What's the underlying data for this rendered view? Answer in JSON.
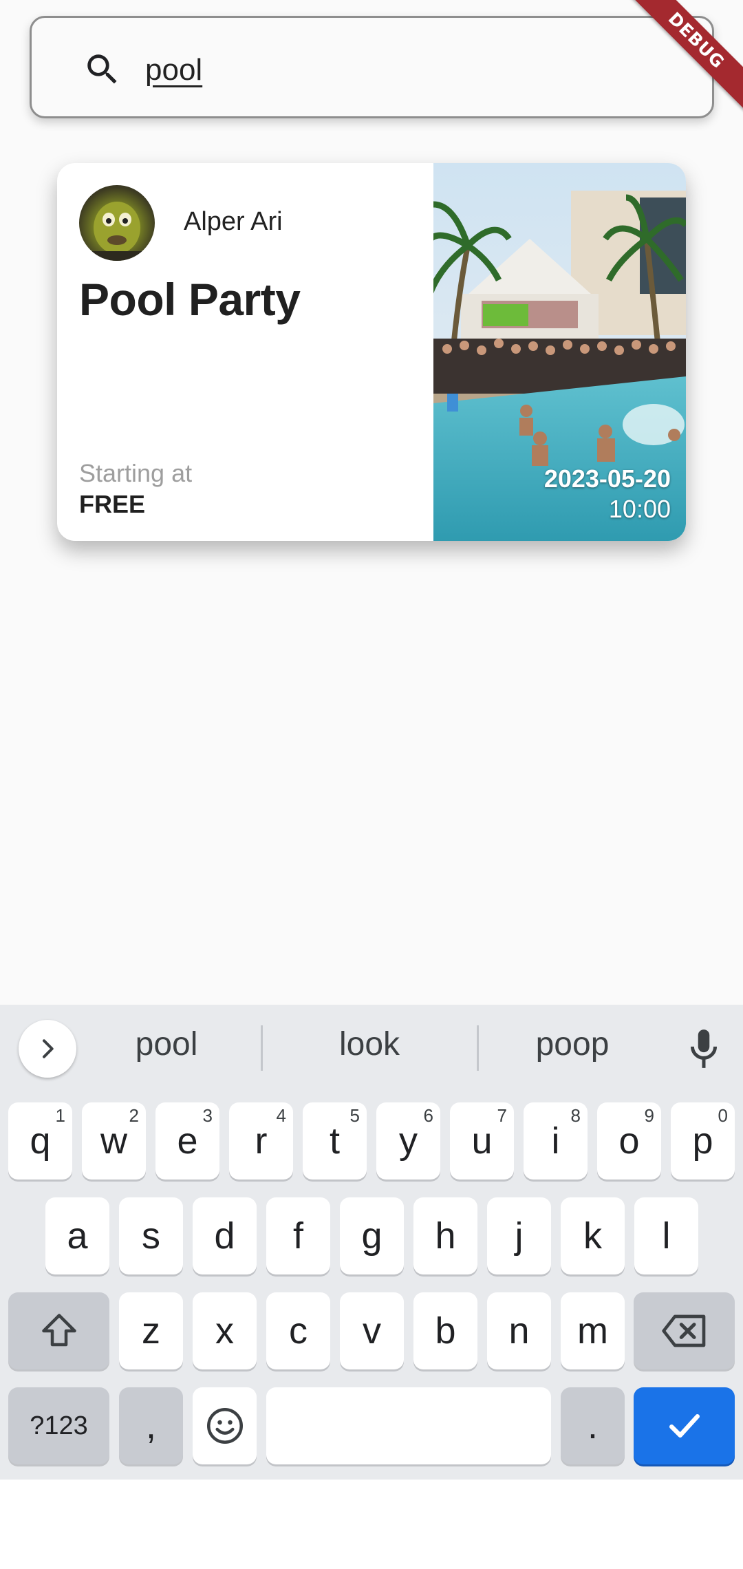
{
  "search": {
    "value": "pool",
    "icon": "search-icon"
  },
  "debug_banner": {
    "label": "DEBUG",
    "color": "#a4292f"
  },
  "event_card": {
    "host_name": "Alper Ari",
    "title": "Pool Party",
    "price_label": "Starting at",
    "price_value": "FREE",
    "date": "2023-05-20",
    "time": "10:00"
  },
  "keyboard": {
    "suggestions": [
      "pool",
      "look",
      "poop"
    ],
    "rows": [
      [
        {
          "label": "q",
          "hint": "1"
        },
        {
          "label": "w",
          "hint": "2"
        },
        {
          "label": "e",
          "hint": "3"
        },
        {
          "label": "r",
          "hint": "4"
        },
        {
          "label": "t",
          "hint": "5"
        },
        {
          "label": "y",
          "hint": "6"
        },
        {
          "label": "u",
          "hint": "7"
        },
        {
          "label": "i",
          "hint": "8"
        },
        {
          "label": "o",
          "hint": "9"
        },
        {
          "label": "p",
          "hint": "0"
        }
      ],
      [
        {
          "label": "a"
        },
        {
          "label": "s"
        },
        {
          "label": "d"
        },
        {
          "label": "f"
        },
        {
          "label": "g"
        },
        {
          "label": "h"
        },
        {
          "label": "j"
        },
        {
          "label": "k"
        },
        {
          "label": "l"
        }
      ],
      [
        {
          "label": "z"
        },
        {
          "label": "x"
        },
        {
          "label": "c"
        },
        {
          "label": "v"
        },
        {
          "label": "b"
        },
        {
          "label": "n"
        },
        {
          "label": "m"
        }
      ]
    ],
    "symbols_key": "?123",
    "comma_key": ",",
    "period_key": ".",
    "accent_color": "#1a73e8"
  }
}
